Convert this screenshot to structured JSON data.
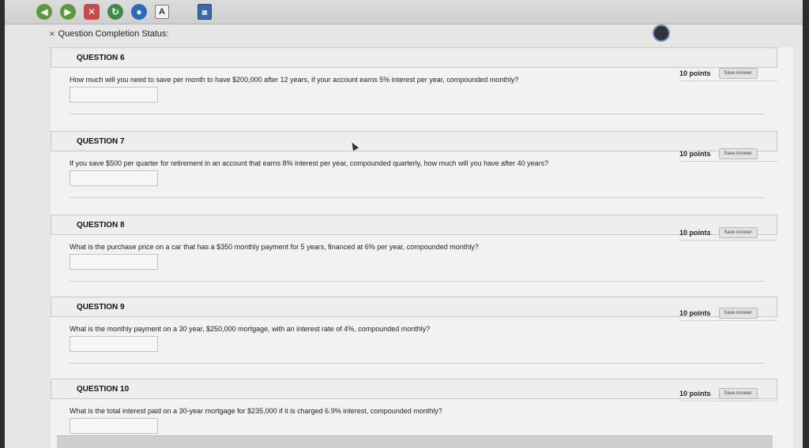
{
  "toolbar": {
    "back_icon": "back-icon",
    "forward_icon": "forward-icon",
    "stop_icon": "stop-icon",
    "refresh_icon": "refresh-icon",
    "globe_icon": "globe-icon",
    "text_icon_label": "A",
    "calculator_icon": "calculator-icon"
  },
  "status": {
    "label": "Question Completion Status:"
  },
  "questions": [
    {
      "header": "QUESTION 6",
      "text": "How much will you need to save per month to have $200,000 after 12 years, if your account earns 5% interest per year, compounded monthly?",
      "points": "10 points",
      "save_label": "Save Answer",
      "answer": ""
    },
    {
      "header": "QUESTION 7",
      "text": "If you save $500 per quarter for retirement in an account that earns 8% interest per year, compounded quarterly, how much will you have after 40 years?",
      "points": "10 points",
      "save_label": "Save Answer",
      "answer": ""
    },
    {
      "header": "QUESTION 8",
      "text": "What is the purchase price on a car that has a $350 monthly payment for 5 years, financed at 6% per year, compounded monthly?",
      "points": "10 points",
      "save_label": "Save Answer",
      "answer": ""
    },
    {
      "header": "QUESTION 9",
      "text": "What is the monthly payment on a 30 year, $250,000 mortgage, with an interest rate of 4%, compounded monthly?",
      "points": "10 points",
      "save_label": "Save Answer",
      "answer": ""
    },
    {
      "header": "QUESTION 10",
      "text": "What is the total interest paid on a 30-year mortgage for $235,000 if it is charged 6.9% interest, compounded monthly?",
      "points": "10 points",
      "save_label": "Save Answer",
      "answer": ""
    }
  ]
}
